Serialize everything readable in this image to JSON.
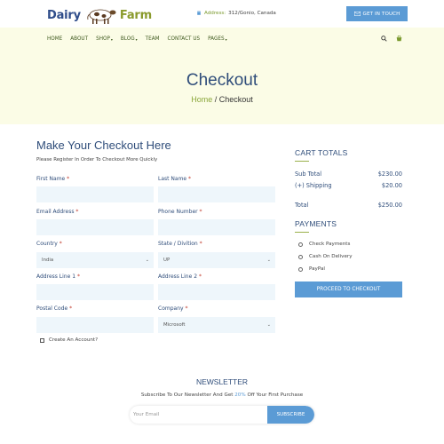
{
  "header": {
    "logo_left": "Dairy",
    "logo_right": "Farm",
    "address_label": "Address:",
    "address_value": "312/Gonio, Canada",
    "get_in_touch": "GET IN TOUCH"
  },
  "nav": {
    "items": [
      {
        "label": "HOME",
        "dropdown": false
      },
      {
        "label": "ABOUT",
        "dropdown": false
      },
      {
        "label": "SHOP",
        "dropdown": true
      },
      {
        "label": "BLOG",
        "dropdown": true
      },
      {
        "label": "TEAM",
        "dropdown": false
      },
      {
        "label": "CONTACT US",
        "dropdown": false
      },
      {
        "label": "PAGES",
        "dropdown": true
      }
    ]
  },
  "hero": {
    "title": "Checkout",
    "crumb_home": "Home",
    "crumb_sep": " / ",
    "crumb_current": "Checkout"
  },
  "form": {
    "title": "Make Your Checkout Here",
    "subtitle": "Please Register In Order To Checkout More Quickly",
    "first_name": "First Name",
    "last_name": "Last Name",
    "email": "Email Address",
    "phone": "Phone Number",
    "country": "Country",
    "country_value": "India",
    "state": "State / Divition",
    "state_value": "UP",
    "address1": "Address Line 1",
    "address2": "Address Line 2",
    "postal": "Postal Code",
    "company": "Company",
    "company_value": "Microsoft",
    "required_mark": "*",
    "create_account": "Create An Account?"
  },
  "cart": {
    "title": "CART TOTALS",
    "subtotal_label": "Sub Total",
    "subtotal_value": "$230.00",
    "shipping_label": "(+) Shipping",
    "shipping_value": "$20.00",
    "total_label": "Total",
    "total_value": "$250.00"
  },
  "payments": {
    "title": "PAYMENTS",
    "options": [
      "Check Payments",
      "Cash On Delivery",
      "PayPal"
    ],
    "proceed": "PROCEED TO CHECKOUT"
  },
  "newsletter": {
    "title": "NEWSLETTER",
    "sub_before": "Subscribe To Our Newsletter And Get ",
    "sub_pct": "20%",
    "sub_after": " Off Your First Purchase",
    "placeholder": "Your Email",
    "button": "SUBSCRIBE"
  },
  "colors": {
    "primary_blue": "#5b9bd5",
    "heading_navy": "#2f4d7a",
    "accent_green": "#8aa63a",
    "cream_bg": "#fbfce6",
    "input_bg": "#eef6fb"
  },
  "icons": [
    "map-pin-icon",
    "mail-icon",
    "search-icon",
    "cart-icon",
    "cow-logo-icon",
    "chevron-down-icon"
  ]
}
